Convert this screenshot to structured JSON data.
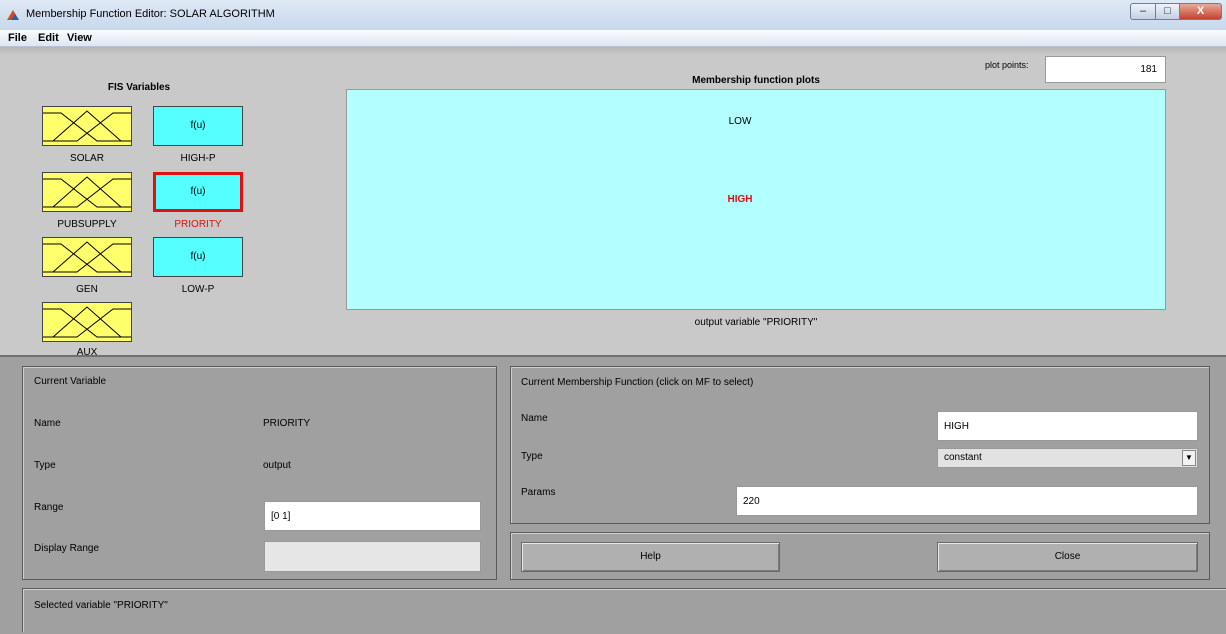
{
  "window": {
    "title": "Membership Function Editor: SOLAR ALGORITHM",
    "min_label": "▭",
    "max_label": "▢",
    "close_label": "X"
  },
  "menu": {
    "file": "File",
    "edit": "Edit",
    "view": "View"
  },
  "fis": {
    "heading": "FIS Variables",
    "inputs": [
      "SOLAR",
      "PUBSUPPLY",
      "GEN",
      "AUX"
    ],
    "outputs": [
      "HIGH-P",
      "PRIORITY",
      "LOW-P"
    ],
    "output_glyph": "f(u)"
  },
  "plot": {
    "title": "Membership function plots",
    "plot_points_label": "plot points:",
    "plot_points_value": "181",
    "mf_low": "LOW",
    "mf_high": "HIGH",
    "caption": "output variable \"PRIORITY\""
  },
  "current_variable": {
    "heading": "Current Variable",
    "name_label": "Name",
    "name_value": "PRIORITY",
    "type_label": "Type",
    "type_value": "output",
    "range_label": "Range",
    "range_value": "[0 1]",
    "display_range_label": "Display Range",
    "display_range_value": ""
  },
  "current_mf": {
    "heading": "Current Membership Function (click on MF to select)",
    "name_label": "Name",
    "name_value": "HIGH",
    "type_label": "Type",
    "type_value": "constant",
    "params_label": "Params",
    "params_value": "220"
  },
  "buttons": {
    "help": "Help",
    "close": "Close"
  },
  "status": "Selected variable \"PRIORITY\"",
  "colors": {
    "input_var": "#ffff6b",
    "output_var": "#55ffff",
    "selected_border": "#e01010",
    "plot_bg": "#b3ffff",
    "selected_text": "#e01010"
  }
}
